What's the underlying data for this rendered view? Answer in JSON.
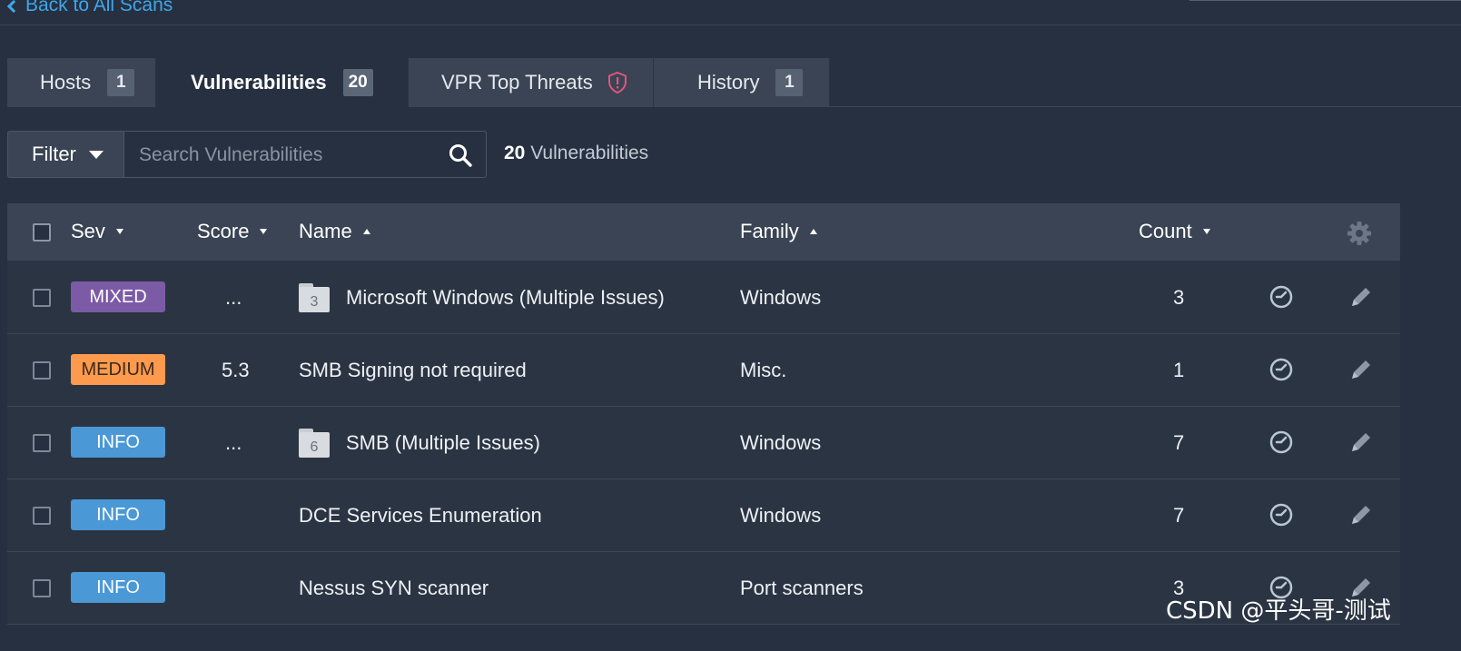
{
  "nav": {
    "back_label": "Back to All Scans"
  },
  "tabs": [
    {
      "label": "Hosts",
      "count": "1"
    },
    {
      "label": "Vulnerabilities",
      "count": "20"
    },
    {
      "label": "VPR Top Threats",
      "icon": "shield-alert-icon"
    },
    {
      "label": "History",
      "count": "1"
    }
  ],
  "filter": {
    "button_label": "Filter",
    "search_placeholder": "Search Vulnerabilities",
    "result_count": "20",
    "result_label": "Vulnerabilities"
  },
  "table": {
    "columns": {
      "sev": "Sev",
      "score": "Score",
      "name": "Name",
      "family": "Family",
      "count": "Count"
    },
    "rows": [
      {
        "sev": "MIXED",
        "sev_color": "#7b5aa6",
        "score": "...",
        "group_count": "3",
        "name": "Microsoft Windows (Multiple Issues)",
        "family": "Windows",
        "count": "3"
      },
      {
        "sev": "MEDIUM",
        "sev_color": "#fd9a4d",
        "score": "5.3",
        "group_count": "",
        "name": "SMB Signing not required",
        "family": "Misc.",
        "count": "1"
      },
      {
        "sev": "INFO",
        "sev_color": "#4a98d6",
        "score": "...",
        "group_count": "6",
        "name": "SMB (Multiple Issues)",
        "family": "Windows",
        "count": "7"
      },
      {
        "sev": "INFO",
        "sev_color": "#4a98d6",
        "score": "",
        "group_count": "",
        "name": "DCE Services Enumeration",
        "family": "Windows",
        "count": "7"
      },
      {
        "sev": "INFO",
        "sev_color": "#4a98d6",
        "score": "",
        "group_count": "",
        "name": "Nessus SYN scanner",
        "family": "Port scanners",
        "count": "3"
      }
    ]
  },
  "watermark": "CSDN @平头哥-测试"
}
